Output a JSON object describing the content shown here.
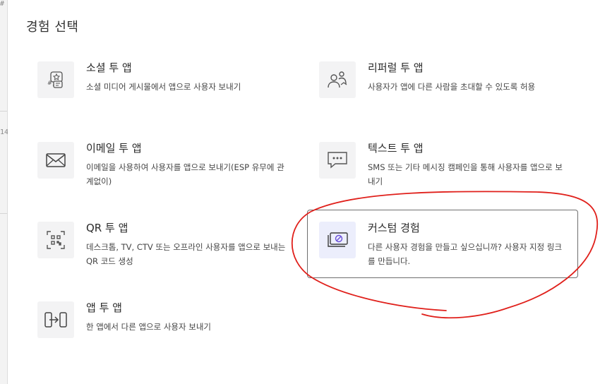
{
  "background": {
    "fragments": [
      "#",
      "14"
    ]
  },
  "dialog": {
    "title": "경험 선택"
  },
  "options": [
    {
      "title": "소셜 투 앱",
      "description": "소셜 미디어 게시물에서 앱으로 사용자 보내기",
      "icon": "social-post-icon",
      "selected": false
    },
    {
      "title": "리퍼럴 투 앱",
      "description": "사용자가 앱에 다른 사람을 초대할 수 있도록 허용",
      "icon": "referral-users-icon",
      "selected": false
    },
    {
      "title": "이메일 투 앱",
      "description": "이메일을 사용하여 사용자를 앱으로 보내기(ESP 유무에 관계없이)",
      "icon": "envelope-icon",
      "selected": false
    },
    {
      "title": "텍스트 투 앱",
      "description": "SMS 또는 기타 메시징 캠페인을 통해 사용자를 앱으로 보내기",
      "icon": "chat-bubble-icon",
      "selected": false
    },
    {
      "title": "QR 투 앱",
      "description": "데스크톱, TV, CTV 또는 오프라인 사용자를 앱으로 보내는 QR 코드 생성",
      "icon": "qr-code-icon",
      "selected": false
    },
    {
      "title": "커스텀 경험",
      "description": "다른 사용자 경험을 만들고 싶으십니까? 사용자 지정 링크를 만듭니다.",
      "icon": "custom-link-icon",
      "selected": true
    },
    {
      "title": "앱 투 앱",
      "description": "한 앱에서 다른 앱으로 사용자 보내기",
      "icon": "app-to-app-icon",
      "selected": false
    }
  ],
  "colors": {
    "annotation": "#e0201b",
    "selected_border": "#6f6f6f",
    "selected_icon_bg": "#eceefc",
    "icon_accent": "#6a4fd8"
  }
}
